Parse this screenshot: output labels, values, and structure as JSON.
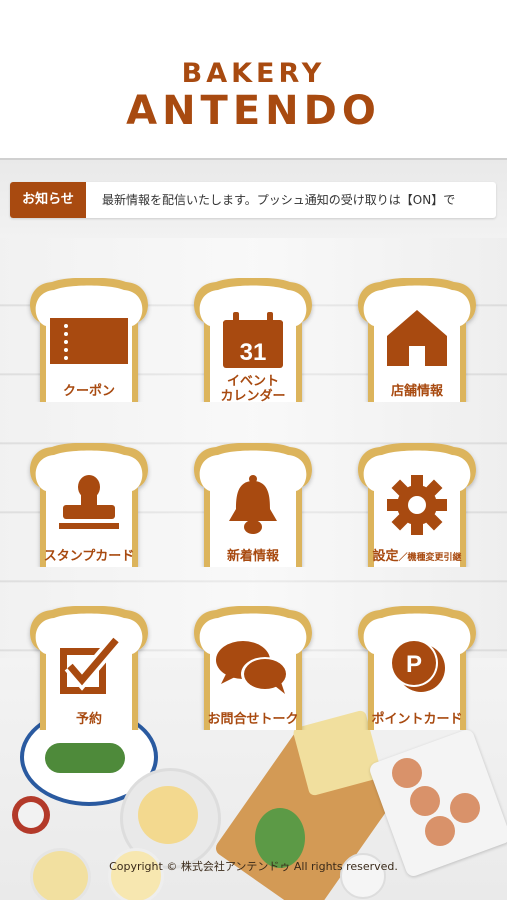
{
  "header": {
    "logo_top": "BAKERY",
    "logo_bottom": "ANTENDO"
  },
  "news": {
    "label": "お知らせ",
    "text": "最新情報を配信いたします。プッシュ通知の受け取りは【ON】で"
  },
  "menu": [
    {
      "label": "クーポン",
      "icon": "coupon-ticket-icon"
    },
    {
      "label": "イベント\nカレンダー",
      "icon": "calendar-icon",
      "calendar_day": "31"
    },
    {
      "label": "店舗情報",
      "icon": "house-icon"
    },
    {
      "label": "スタンプカード",
      "icon": "stamp-icon"
    },
    {
      "label": "新着情報",
      "icon": "bell-icon"
    },
    {
      "label": "設定",
      "sublabel": "／機種変更引継",
      "icon": "gear-icon"
    },
    {
      "label": "予約",
      "icon": "checkbox-icon"
    },
    {
      "label": "お問合せトーク",
      "icon": "chat-bubbles-icon"
    },
    {
      "label": "ポイントカード",
      "icon": "point-coin-icon",
      "coin_letter": "P"
    }
  ],
  "footer": {
    "copyright": "Copyright © 株式会社アンテンドゥ All rights reserved."
  },
  "colors": {
    "brand": "#a84a10",
    "crust": "#dcb45c"
  }
}
